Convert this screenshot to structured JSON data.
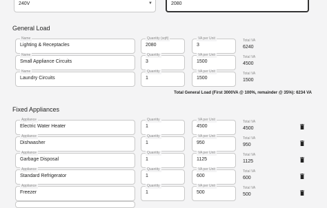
{
  "top": {
    "voltage_value": "240V",
    "area_value": "2080"
  },
  "general_load": {
    "title": "General Load",
    "rows": [
      {
        "name_label": "Name",
        "name": "Lighting & Receptacles",
        "qty_label": "Quantity (sqft)",
        "qty": "2080",
        "va_label": "VA per Unit",
        "va": "3",
        "total_label": "Total VA",
        "total": "6240"
      },
      {
        "name_label": "Name",
        "name": "Small Appliance Circuits",
        "qty_label": "Quantity",
        "qty": "3",
        "va_label": "VA per Unit",
        "va": "1500",
        "total_label": "Total VA",
        "total": "4500"
      },
      {
        "name_label": "Name",
        "name": "Laundry Circuits",
        "qty_label": "Quantity",
        "qty": "1",
        "va_label": "VA per Unit",
        "va": "1500",
        "total_label": "Total VA",
        "total": "1500"
      }
    ],
    "total_text": "Total General Load (First 3000VA @ 100%, remainder @ 35%): 6234 VA"
  },
  "fixed_appliances": {
    "title": "Fixed Appliances",
    "rows": [
      {
        "name_label": "Appliance",
        "name": "Electric Water Heater",
        "qty_label": "Quantity",
        "qty": "1",
        "va_label": "VA per Unit",
        "va": "4500",
        "total_label": "Total VA",
        "total": "4500"
      },
      {
        "name_label": "Appliance",
        "name": "Dishwasher",
        "qty_label": "Quantity",
        "qty": "1",
        "va_label": "VA per Unit",
        "va": "950",
        "total_label": "Total VA",
        "total": "950"
      },
      {
        "name_label": "Appliance",
        "name": "Garbage Disposal",
        "qty_label": "Quantity",
        "qty": "1",
        "va_label": "VA per Unit",
        "va": "1125",
        "total_label": "Total VA",
        "total": "1125"
      },
      {
        "name_label": "Appliance",
        "name": "Standard Refrigerator",
        "qty_label": "Quantity",
        "qty": "1",
        "va_label": "VA per Unit",
        "va": "600",
        "total_label": "Total VA",
        "total": "600"
      },
      {
        "name_label": "Appliance",
        "name": "Freezer",
        "qty_label": "Quantity",
        "qty": "1",
        "va_label": "VA per Unit",
        "va": "500",
        "total_label": "Total VA",
        "total": "500"
      }
    ]
  }
}
